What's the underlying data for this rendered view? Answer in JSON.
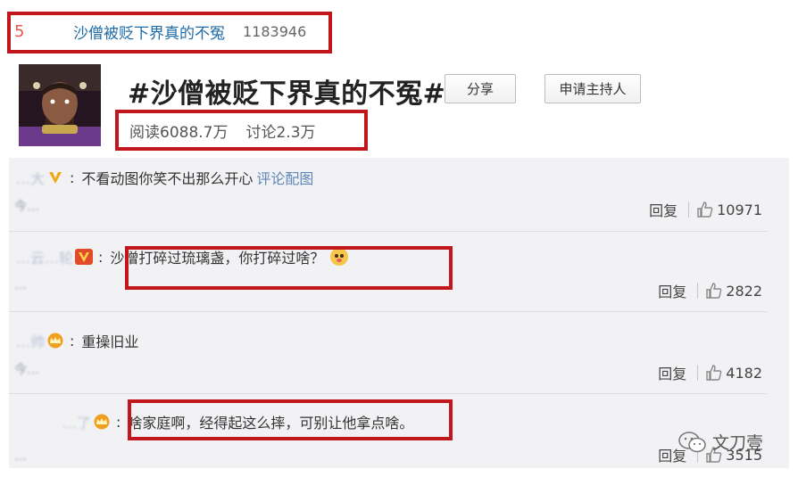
{
  "trending": {
    "rank": "5",
    "title": "沙僧被贬下界真的不冤",
    "count": "1183946"
  },
  "topic": {
    "title": "#沙僧被贬下界真的不冤#",
    "share_label": "分享",
    "host_label": "申请主持人",
    "reads": "阅读6088.7万",
    "discussions": "讨论2.3万"
  },
  "comments": [
    {
      "username": "…大",
      "text": "不看动图你笑不出那么开心",
      "link": "评论配图",
      "time": "今…",
      "reply_label": "回复",
      "likes": "10971",
      "badge": "vip-yellow"
    },
    {
      "username": "…云…轮",
      "text": "沙僧打碎过琉璃盏，你打碎过啥？",
      "time": "…",
      "reply_label": "回复",
      "likes": "2822",
      "badge": "vip-red"
    },
    {
      "username": "…帅",
      "text": "重操旧业",
      "time": "今…",
      "reply_label": "回复",
      "likes": "4182",
      "badge": "crown"
    },
    {
      "username": "…了",
      "text": "啥家庭啊，经得起这么摔，可别让他拿点啥。",
      "time": "…",
      "reply_label": "回复",
      "likes": "3515",
      "badge": "crown"
    }
  ],
  "watermark": {
    "text": "文刀壹"
  },
  "colors": {
    "highlight_box": "#c0161c",
    "link": "#5d86b8",
    "trend_title": "#1f6ba7"
  }
}
